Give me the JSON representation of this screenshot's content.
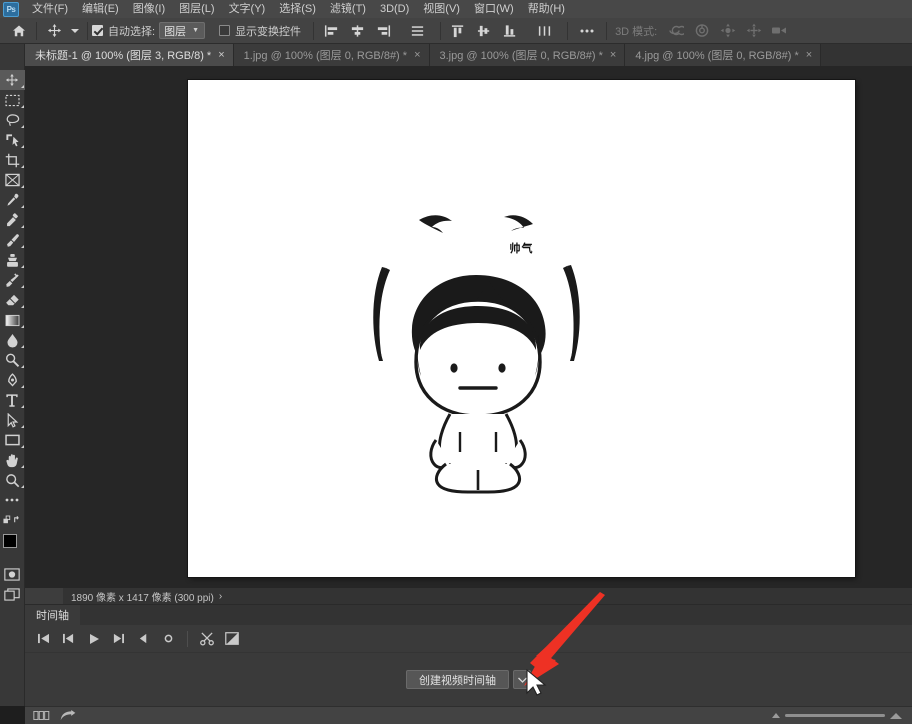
{
  "app": {
    "logo_text": "Ps",
    "logo_color": "#2d6e9e"
  },
  "menubar": {
    "items": [
      {
        "label": "文件(F)",
        "name": "menu-file"
      },
      {
        "label": "编辑(E)",
        "name": "menu-edit"
      },
      {
        "label": "图像(I)",
        "name": "menu-image"
      },
      {
        "label": "图层(L)",
        "name": "menu-layer"
      },
      {
        "label": "文字(Y)",
        "name": "menu-type"
      },
      {
        "label": "选择(S)",
        "name": "menu-select"
      },
      {
        "label": "滤镜(T)",
        "name": "menu-filter"
      },
      {
        "label": "3D(D)",
        "name": "menu-3d"
      },
      {
        "label": "视图(V)",
        "name": "menu-view"
      },
      {
        "label": "窗口(W)",
        "name": "menu-window"
      },
      {
        "label": "帮助(H)",
        "name": "menu-help"
      }
    ]
  },
  "options_bar": {
    "auto_select_label": "自动选择:",
    "auto_select_checked": true,
    "auto_select_value": "图层",
    "show_transform_label": "显示变换控件",
    "show_transform_checked": false,
    "more_label": "•••",
    "mode_3d_label": "3D 模式:"
  },
  "tabs": [
    {
      "title": "未标题-1 @ 100% (图层 3, RGB/8) *",
      "close": "×",
      "active": true
    },
    {
      "title": "1.jpg @ 100% (图层 0, RGB/8#) *",
      "close": "×",
      "active": false
    },
    {
      "title": "3.jpg @ 100% (图层 0, RGB/8#) *",
      "close": "×",
      "active": false
    },
    {
      "title": "4.jpg @ 100% (图层 0, RGB/8#) *",
      "close": "×",
      "active": false
    }
  ],
  "toolbar": {
    "tools": [
      {
        "name": "move-tool-icon",
        "selected": true
      },
      {
        "name": "rectangular-marquee-tool-icon",
        "selected": false
      },
      {
        "name": "lasso-tool-icon",
        "selected": false
      },
      {
        "name": "quick-selection-tool-icon",
        "selected": false
      },
      {
        "name": "crop-tool-icon",
        "selected": false
      },
      {
        "name": "frame-tool-icon",
        "selected": false
      },
      {
        "name": "eyedropper-tool-icon",
        "selected": false
      },
      {
        "name": "spot-healing-brush-tool-icon",
        "selected": false
      },
      {
        "name": "brush-tool-icon",
        "selected": false
      },
      {
        "name": "clone-stamp-tool-icon",
        "selected": false
      },
      {
        "name": "history-brush-tool-icon",
        "selected": false
      },
      {
        "name": "eraser-tool-icon",
        "selected": false
      },
      {
        "name": "gradient-tool-icon",
        "selected": false
      },
      {
        "name": "blur-tool-icon",
        "selected": false
      },
      {
        "name": "dodge-tool-icon",
        "selected": false
      },
      {
        "name": "pen-tool-icon",
        "selected": false
      },
      {
        "name": "horizontal-type-tool-icon",
        "selected": false
      },
      {
        "name": "path-selection-tool-icon",
        "selected": false
      },
      {
        "name": "rectangle-tool-icon",
        "selected": false
      },
      {
        "name": "hand-tool-icon",
        "selected": false
      },
      {
        "name": "zoom-tool-icon",
        "selected": false
      },
      {
        "name": "edit-toolbar-icon",
        "selected": false
      }
    ],
    "foreground_color": "#000000",
    "background_color": "#ffffff"
  },
  "canvas": {
    "artwork_text": "帅气",
    "background": "#ffffff"
  },
  "statusbar": {
    "text": "1890 像素 x 1417 像素 (300 ppi)",
    "caret": "›"
  },
  "timeline": {
    "panel_tab": "时间轴",
    "controls": [
      {
        "name": "go-to-first-frame-button"
      },
      {
        "name": "previous-frame-button"
      },
      {
        "name": "play-button"
      },
      {
        "name": "next-frame-button"
      },
      {
        "name": "audio-button"
      },
      {
        "name": "record-keyframe-button"
      },
      {
        "name": "split-at-playhead-button"
      },
      {
        "name": "transition-button"
      }
    ],
    "create_button_label": "创建视频时间轴",
    "create_caret": "⌄"
  },
  "annotation": {
    "arrow_color": "#ee3124"
  }
}
